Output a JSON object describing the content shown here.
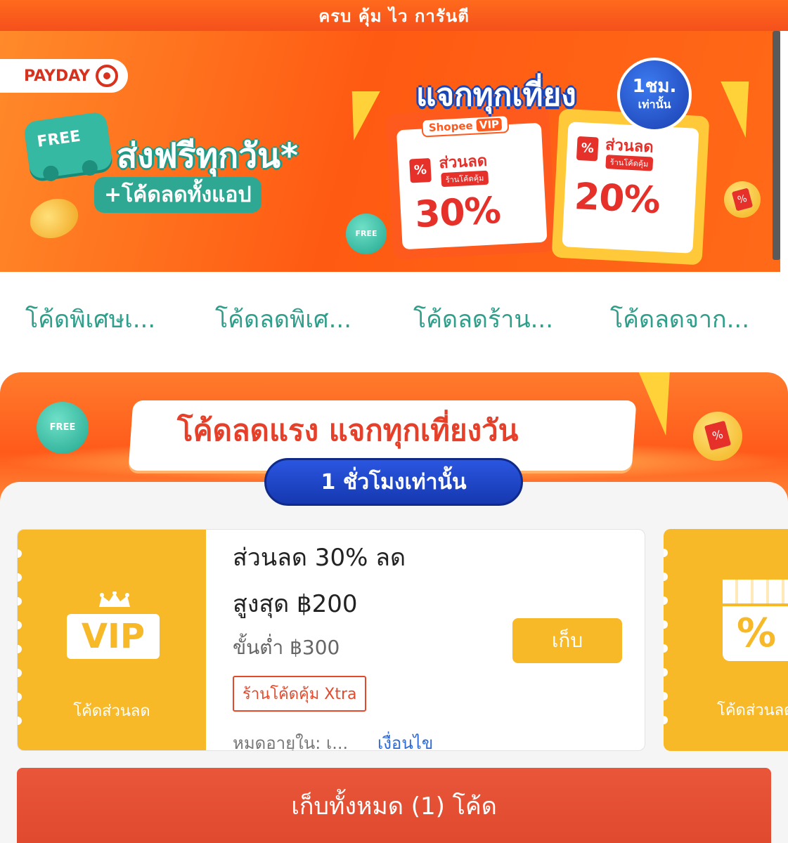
{
  "top_strip": {
    "text": "ครบ คุ้ม ไว การันตี"
  },
  "hero": {
    "payday": "PAYDAY",
    "free_badge": "FREE",
    "headline": "ส่งฟรีทุกวัน*",
    "sub": "+โค้ดลดทั้งแอป",
    "promo_title": "แจกทุกเที่ยง",
    "promo_badge_top": "1ชม.",
    "promo_badge_bottom": "เท่านั้น",
    "ticket_vip_label": "Shopee",
    "ticket_vip_tag": "VIP",
    "ticket1": {
      "label": "ส่วนลด",
      "sub": "ร้านโค้ดคุ้ม",
      "pct": "30%"
    },
    "ticket2": {
      "label": "ส่วนลด",
      "sub": "ร้านโค้ดคุ้ม",
      "pct": "20%"
    },
    "free_ball": "FREE"
  },
  "tabs": [
    "โค้ดพิเศษเ...",
    "โค้ดลดพิเศ...",
    "โค้ดลดร้าน...",
    "โค้ดลดจาก..."
  ],
  "flash": {
    "title": "โค้ดลดแรง แจกทุกเที่ยงวัน",
    "pill": "1 ชั่วโมงเท่านั้น",
    "free_ball": "FREE"
  },
  "voucher": {
    "badge": "VIP",
    "left_label": "โค้ดส่วนลด",
    "line1": "ส่วนลด 30% ลด",
    "line2": "สูงสุด ฿200",
    "min_spend": "ขั้นต่ำ ฿300",
    "tag": "ร้านโค้ดคุ้ม Xtra",
    "expire": "หมดอายุใน: เ...",
    "terms": "เงื่อนไข",
    "collect": "เก็บ"
  },
  "voucher2": {
    "icon_text": "%",
    "label": "โค้ดส่วนลด"
  },
  "collect_all": "เก็บทั้งหมด (1) โค้ด"
}
